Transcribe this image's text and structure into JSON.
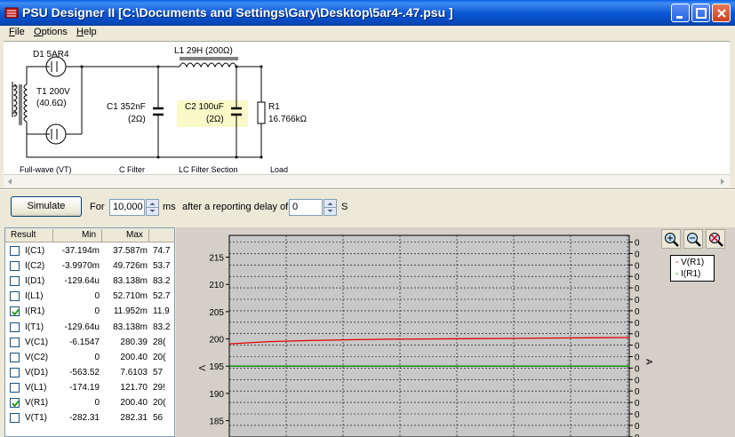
{
  "window": {
    "title": "PSU Designer II  [C:\\Documents and Settings\\Gary\\Desktop\\5ar4-.47.psu ]",
    "buttons": [
      "minimize",
      "maximize",
      "close"
    ]
  },
  "menu": [
    {
      "label": "File",
      "key": "F"
    },
    {
      "label": "Options",
      "key": "O"
    },
    {
      "label": "Help",
      "key": "H"
    }
  ],
  "schematic": {
    "d1": "D1 5AR4",
    "t1_name": "T1 200V",
    "t1_res": "(40.6Ω)",
    "l1": "L1 29H (200Ω)",
    "c1_name": "C1 352nF",
    "c1_res": "(2Ω)",
    "c2_name": "C2 100uF",
    "c2_res": "(2Ω)",
    "r1_name": "R1",
    "r1_val": "16.766kΩ",
    "sections": [
      "Full-wave (VT)",
      "C Filter",
      "LC Filter Section",
      "Load"
    ]
  },
  "simulate": {
    "button": "Simulate",
    "for_label": "For",
    "duration": "10,000",
    "ms_label": "ms",
    "delay_label": "after a reporting delay of",
    "delay": "0",
    "s_label": "S"
  },
  "results": {
    "headers": [
      "Result",
      "Min",
      "Max",
      ""
    ],
    "rows": [
      {
        "name": "I(C1)",
        "checked": false,
        "min": "-37.194m",
        "max": "37.587m",
        "extra": "74.7"
      },
      {
        "name": "I(C2)",
        "checked": false,
        "min": "-3.9970m",
        "max": "49.726m",
        "extra": "53.7"
      },
      {
        "name": "I(D1)",
        "checked": false,
        "min": "-129.64u",
        "max": "83.138m",
        "extra": "83.2"
      },
      {
        "name": "I(L1)",
        "checked": false,
        "min": "0",
        "max": "52.710m",
        "extra": "52.7"
      },
      {
        "name": "I(R1)",
        "checked": true,
        "min": "0",
        "max": "11.952m",
        "extra": "11.9"
      },
      {
        "name": "I(T1)",
        "checked": false,
        "min": "-129.64u",
        "max": "83.138m",
        "extra": "83.2"
      },
      {
        "name": "V(C1)",
        "checked": false,
        "min": "-6.1547",
        "max": "280.39",
        "extra": "28("
      },
      {
        "name": "V(C2)",
        "checked": false,
        "min": "0",
        "max": "200.40",
        "extra": "20("
      },
      {
        "name": "V(D1)",
        "checked": false,
        "min": "-563.52",
        "max": "7.6103",
        "extra": "57"
      },
      {
        "name": "V(L1)",
        "checked": false,
        "min": "-174.19",
        "max": "121.70",
        "extra": "29!"
      },
      {
        "name": "V(R1)",
        "checked": true,
        "min": "0",
        "max": "200.40",
        "extra": "20("
      },
      {
        "name": "V(T1)",
        "checked": false,
        "min": "-282.31",
        "max": "282.31",
        "extra": "56"
      }
    ]
  },
  "graph": {
    "left_axis_label": "V",
    "right_axis_label": "A",
    "left_ticks": [
      "215",
      "210",
      "205",
      "200",
      "195",
      "190",
      "185"
    ],
    "right_ticks": [
      "0",
      "0",
      "0",
      "0",
      "0",
      "0",
      "0",
      "0",
      "0",
      "0",
      "0",
      "0",
      "0",
      "0",
      "0",
      "0",
      "0",
      "0"
    ],
    "legend": [
      "V(R1)",
      "I(R1)"
    ],
    "colors": {
      "V(R1)": "#e00000",
      "I(R1)": "#009000"
    },
    "zoom_buttons": [
      "zoom-in",
      "zoom-out",
      "zoom-reset"
    ]
  },
  "chart_data": {
    "type": "line",
    "ylim": [
      182,
      219
    ],
    "series": [
      {
        "name": "V(R1)",
        "values": [
          199.1,
          199.5,
          199.7,
          199.85,
          199.95,
          200.0,
          200.05,
          200.1,
          200.15,
          200.2,
          200.25
        ]
      },
      {
        "name": "I(R1)",
        "values": [
          195.0,
          195.0
        ]
      }
    ]
  }
}
